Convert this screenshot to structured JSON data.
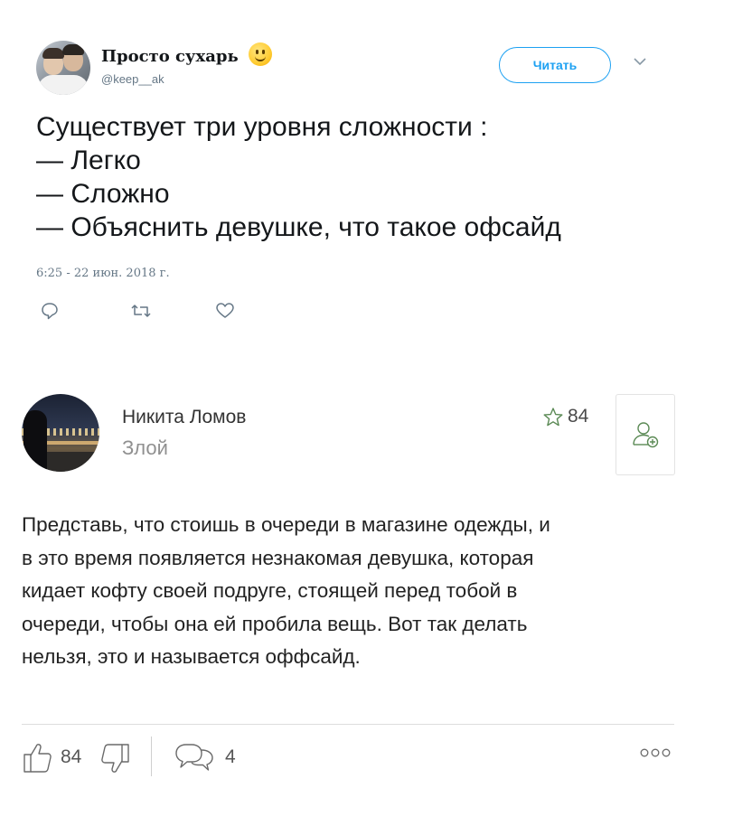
{
  "tweet": {
    "author_name": "Просто сухарь",
    "author_handle": "@keep__ak",
    "emoji_icon": "slightly-smiling-face-emoji",
    "follow_label": "Читать",
    "text_lines": [
      "Существует три уровня сложности :",
      "— Легко",
      "— Сложно",
      "— Объяснить девушке, что такое офсайд"
    ],
    "timestamp": "6:25 - 22 июн. 2018 г.",
    "actions": [
      {
        "icon": "reply-icon"
      },
      {
        "icon": "retweet-icon"
      },
      {
        "icon": "like-heart-icon"
      }
    ],
    "accent_color": "#1da1f2"
  },
  "comment": {
    "author_name": "Никита Ломов",
    "status": "Злой",
    "rating": "84",
    "rating_icon": "star-outline-icon",
    "follow_icon": "add-user-icon",
    "text_lines": [
      "Представь, что стоишь в очереди в магазине одежды, и",
      "в это время появляется незнакомая девушка, которая",
      "кидает кофту своей подруге, стоящей перед тобой в",
      "очереди, чтобы она ей пробила вещь. Вот так делать",
      "нельзя, это и называется оффсайд."
    ],
    "likes": "84",
    "replies": "4",
    "action_icons": [
      "thumbs-up-icon",
      "thumbs-down-icon",
      "comment-bubble-icon",
      "more-dots-icon"
    ]
  }
}
